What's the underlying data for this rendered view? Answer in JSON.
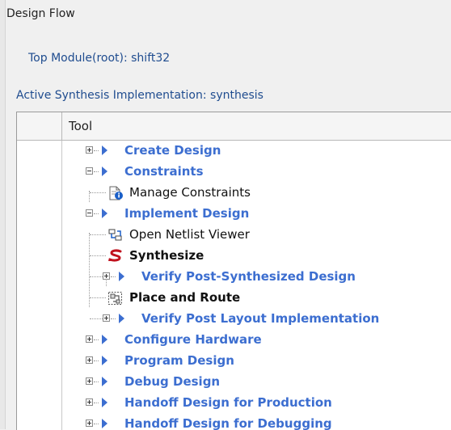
{
  "panel": {
    "title": "Design Flow",
    "top_module": "Top Module(root): shift32",
    "active_impl": "Active Synthesis Implementation: synthesis"
  },
  "tree": {
    "header": "Tool",
    "rows": [
      {
        "label": "Create Design",
        "type": "category",
        "expander": "plus"
      },
      {
        "label": "Constraints",
        "type": "category",
        "expander": "minus"
      },
      {
        "label": "Manage Constraints",
        "type": "item",
        "icon": "constraints-info-icon"
      },
      {
        "label": "Implement Design",
        "type": "category",
        "expander": "minus"
      },
      {
        "label": "Open Netlist Viewer",
        "type": "item",
        "icon": "netlist-viewer-icon"
      },
      {
        "label": "Synthesize",
        "type": "item-bold",
        "icon": "synthesize-icon"
      },
      {
        "label": "Verify Post-Synthesized Design",
        "type": "subcategory",
        "expander": "plus"
      },
      {
        "label": "Place and Route",
        "type": "item-bold",
        "icon": "place-route-icon"
      },
      {
        "label": "Verify Post Layout Implementation",
        "type": "subcategory",
        "expander": "plus"
      },
      {
        "label": "Configure Hardware",
        "type": "category",
        "expander": "plus"
      },
      {
        "label": "Program Design",
        "type": "category",
        "expander": "plus"
      },
      {
        "label": "Debug Design",
        "type": "category",
        "expander": "plus"
      },
      {
        "label": "Handoff Design for Production",
        "type": "category",
        "expander": "plus"
      },
      {
        "label": "Handoff Design for Debugging",
        "type": "category",
        "expander": "plus"
      }
    ]
  },
  "colors": {
    "category_text": "#3c6ed0",
    "info_text": "#1f4c8f",
    "synthesize_icon": "#c0121e",
    "info_badge": "#1a5fc8"
  }
}
